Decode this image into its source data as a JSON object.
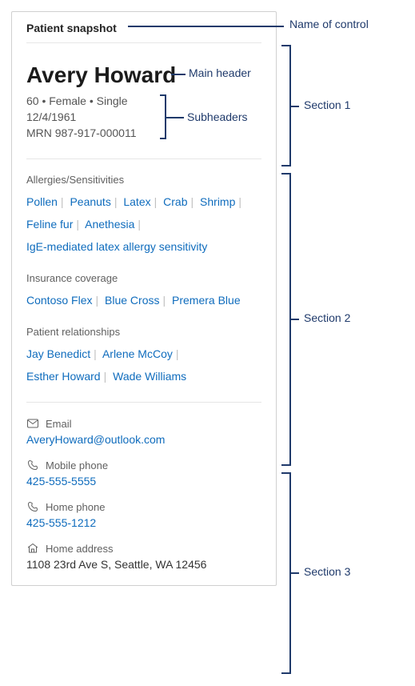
{
  "control_title": "Patient snapshot",
  "patient": {
    "name": "Avery Howard",
    "demographics": "60 • Female • Single",
    "dob": "12/4/1961",
    "mrn": "MRN 987-917-000011"
  },
  "allergies": {
    "label": "Allergies/Sensitivities",
    "items": [
      "Pollen",
      "Peanuts",
      "Latex",
      "Crab",
      "Shrimp",
      "Feline fur",
      "Anethesia",
      "IgE-mediated latex allergy sensitivity"
    ]
  },
  "insurance": {
    "label": "Insurance coverage",
    "items": [
      "Contoso Flex",
      "Blue Cross",
      "Premera Blue"
    ]
  },
  "relationships": {
    "label": "Patient relationships",
    "items": [
      "Jay Benedict",
      "Arlene McCoy",
      "Esther Howard",
      "Wade Williams"
    ]
  },
  "contact": {
    "email_label": "Email",
    "email_value": "AveryHoward@outlook.com",
    "mobile_label": "Mobile phone",
    "mobile_value": "425-555-5555",
    "home_phone_label": "Home phone",
    "home_phone_value": "425-555-1212",
    "address_label": "Home address",
    "address_value": "1108 23rd Ave S, Seattle, WA 12456"
  },
  "annotations": {
    "name_of_control": "Name of control",
    "main_header": "Main header",
    "subheaders": "Subheaders",
    "section1": "Section 1",
    "section2": "Section 2",
    "section3": "Section 3"
  }
}
